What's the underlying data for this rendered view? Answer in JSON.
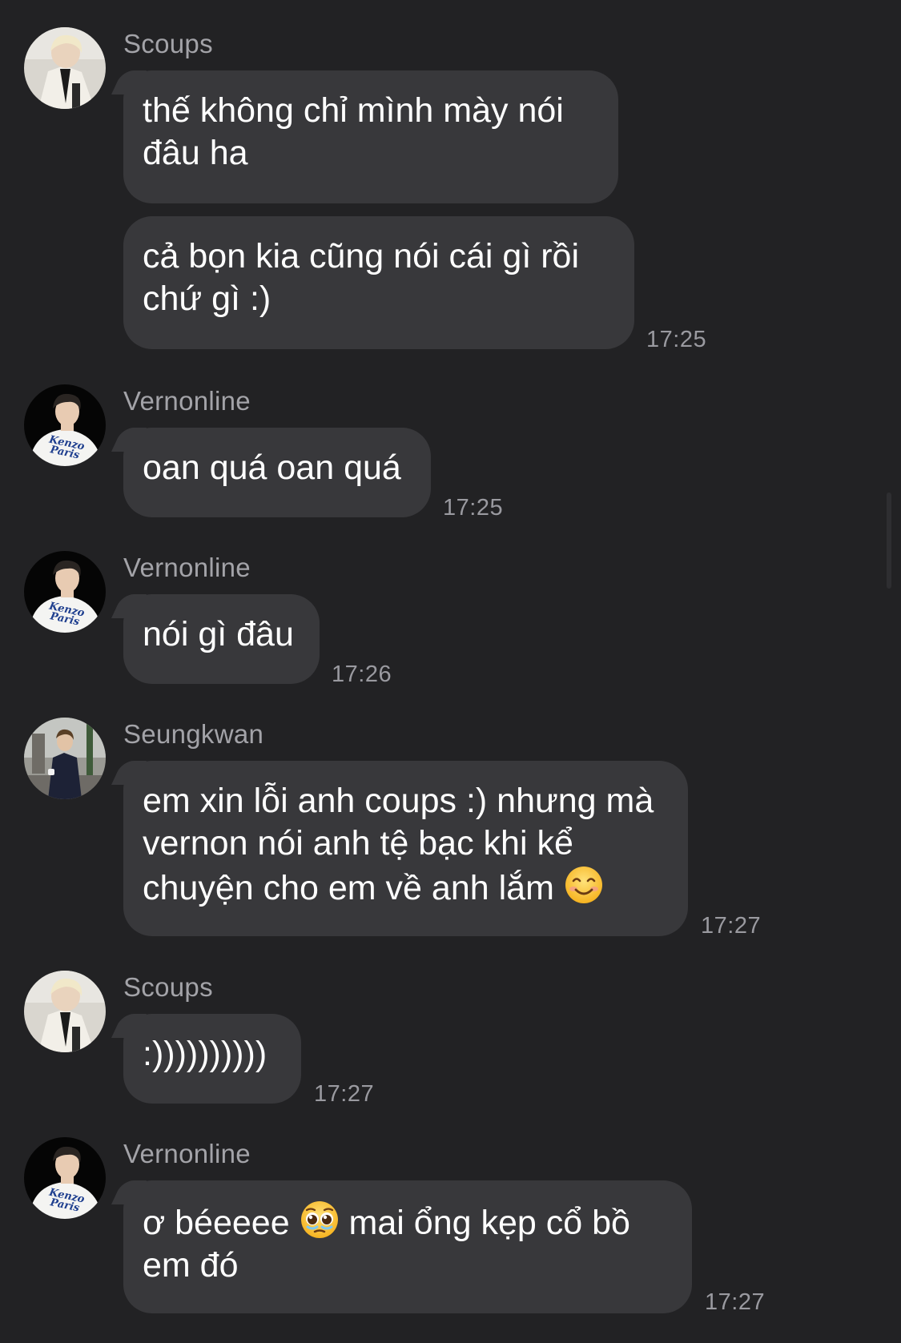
{
  "messages": [
    {
      "sender": "Scoups",
      "avatar": "scoups-avatar",
      "bubbles": [
        {
          "text": "thế không chỉ mình mày nói đâu ha"
        },
        {
          "text": "cả bọn kia cũng nói cái gì rồi chứ gì :)"
        }
      ],
      "time": "17:25"
    },
    {
      "sender": "Vernonline",
      "avatar": "vernon-avatar",
      "bubbles": [
        {
          "text": "oan quá oan quá"
        }
      ],
      "time": "17:25"
    },
    {
      "sender": "Vernonline",
      "avatar": "vernon-avatar",
      "bubbles": [
        {
          "text": "nói gì đâu"
        }
      ],
      "time": "17:26"
    },
    {
      "sender": "Seungkwan",
      "avatar": "seungkwan-avatar",
      "bubbles": [
        {
          "text": "em xin lỗi anh coups :) nhưng mà vernon nói anh tệ bạc khi kể chuyện cho em về anh lắm",
          "emoji": "smiling-face-icon"
        }
      ],
      "time": "17:27"
    },
    {
      "sender": "Scoups",
      "avatar": "scoups-avatar",
      "bubbles": [
        {
          "text": ":))))))))))"
        }
      ],
      "time": "17:27"
    },
    {
      "sender": "Vernonline",
      "avatar": "vernon-avatar",
      "bubbles": [
        {
          "text_before": "ơ béeeee",
          "emoji": "pleading-face-icon",
          "text_after": "mai ổng kẹp cổ bồ em đó"
        }
      ],
      "time": "17:27"
    }
  ],
  "avatar_print": "Kenzo Paris",
  "colors": {
    "background": "#222224",
    "bubble": "#38383b",
    "sender_name": "#a3a3a8",
    "timestamp": "#9a9aa0",
    "text": "#ffffff"
  }
}
